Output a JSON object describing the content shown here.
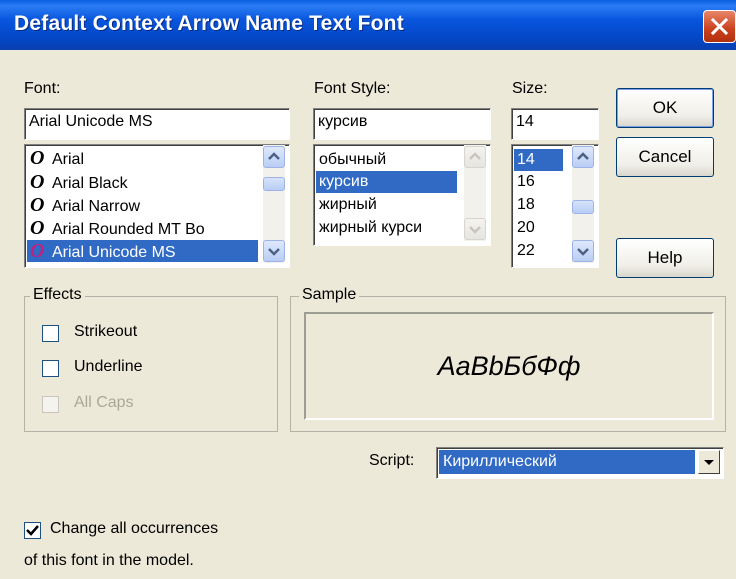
{
  "window": {
    "title": "Default Context Arrow Name Text Font"
  },
  "font": {
    "label": "Font:",
    "value": "Arial Unicode MS",
    "items": [
      "Arial",
      "Arial Black",
      "Arial Narrow",
      "Arial Rounded MT Bo",
      "Arial Unicode MS"
    ],
    "selected_index": 4
  },
  "style": {
    "label": "Font Style:",
    "value": "курсив",
    "items": [
      "обычный",
      "курсив",
      "жирный",
      "жирный курси"
    ],
    "selected_index": 1
  },
  "size": {
    "label": "Size:",
    "value": "14",
    "items": [
      "14",
      "16",
      "18",
      "20",
      "22"
    ],
    "selected_index": 0
  },
  "buttons": {
    "ok": "OK",
    "cancel": "Cancel",
    "help": "Help"
  },
  "effects": {
    "label": "Effects",
    "strikeout": {
      "label": "Strikeout",
      "checked": false
    },
    "underline": {
      "label": "Underline",
      "checked": false
    },
    "allcaps": {
      "label": "All Caps",
      "checked": false,
      "disabled": true
    }
  },
  "sample": {
    "label": "Sample",
    "text": "AaBbБбФф"
  },
  "script": {
    "label": "Script:",
    "value": "Кириллический"
  },
  "change_all": {
    "line1": "Change all occurrences",
    "line2": "of this font in the model.",
    "checked": true
  },
  "colors": {
    "titlebar": "#0a54d8",
    "selection": "#316ac5",
    "dialog": "#ece9d8"
  }
}
